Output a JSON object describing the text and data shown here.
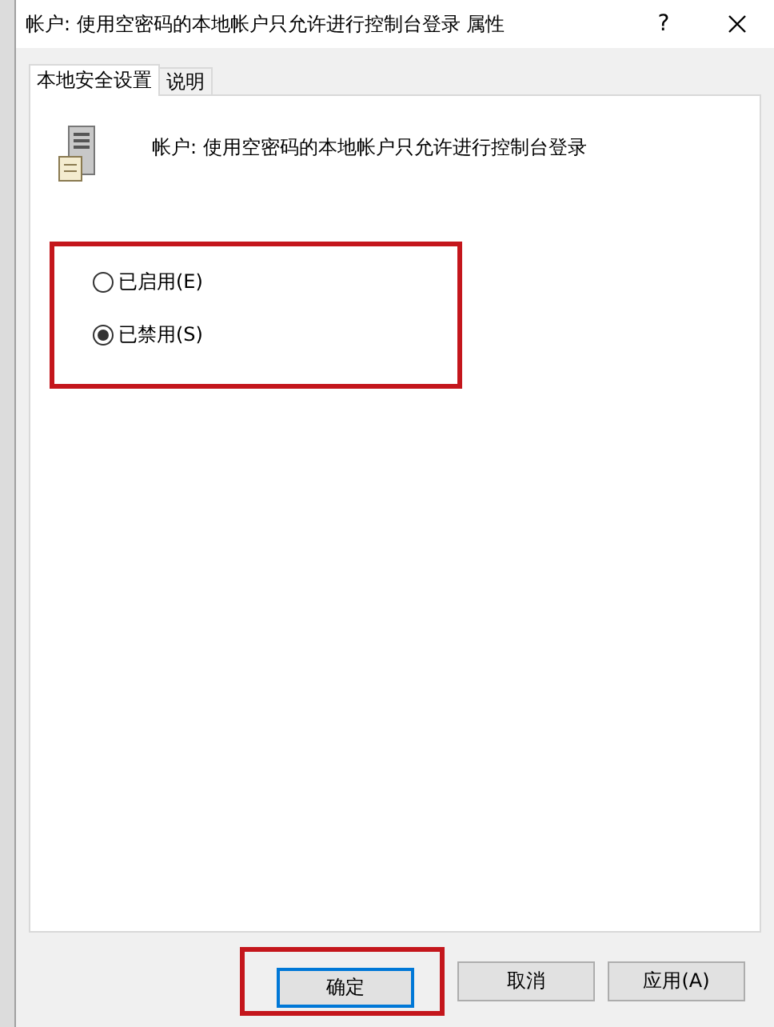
{
  "window": {
    "title": "帐户: 使用空密码的本地帐户只允许进行控制台登录 属性",
    "help": "?"
  },
  "tabs": [
    {
      "label": "本地安全设置",
      "selected": true
    },
    {
      "label": "说明",
      "selected": false
    }
  ],
  "policy": {
    "title": "帐户: 使用空密码的本地帐户只允许进行控制台登录"
  },
  "options_group": {
    "highlighted": true,
    "options": [
      {
        "label": "已启用(E)",
        "selected": false
      },
      {
        "label": "已禁用(S)",
        "selected": true
      }
    ]
  },
  "buttons": [
    {
      "label": "确定",
      "default": true,
      "highlighted": true
    },
    {
      "label": "取消",
      "default": false,
      "highlighted": false
    },
    {
      "label": "应用(A)",
      "default": false,
      "highlighted": false
    }
  ]
}
